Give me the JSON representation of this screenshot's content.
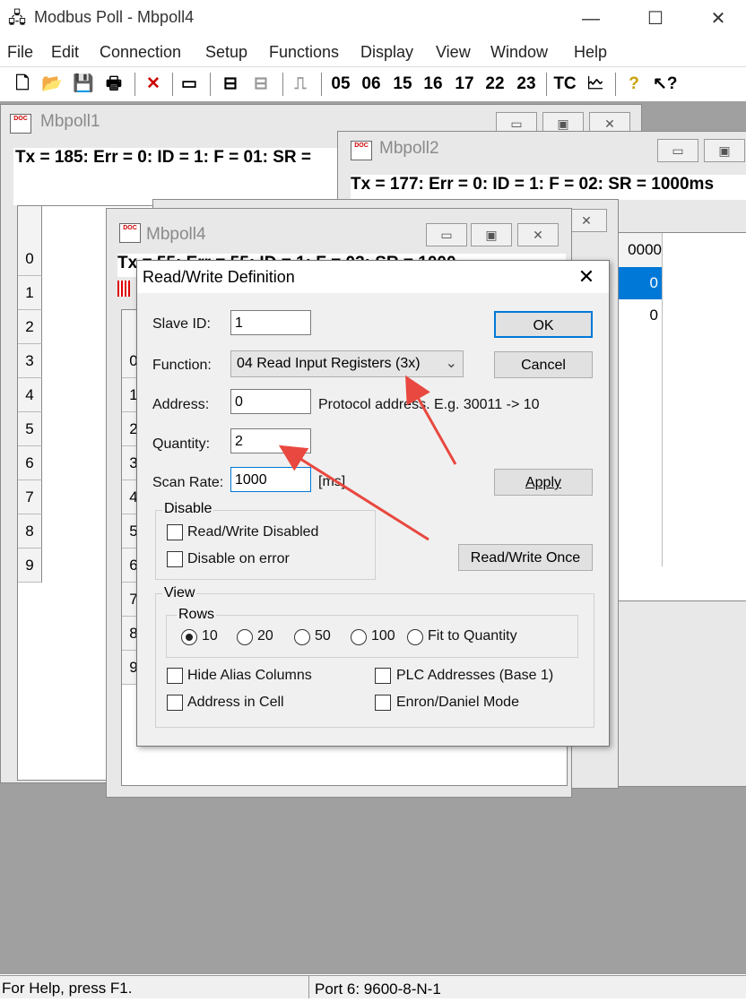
{
  "window": {
    "title": "Modbus Poll - Mbpoll4",
    "minimize_glyph": "—",
    "maximize_glyph": "☐",
    "close_glyph": "✕"
  },
  "menu": [
    "File",
    "Edit",
    "Connection",
    "Setup",
    "Functions",
    "Display",
    "View",
    "Window",
    "Help"
  ],
  "toolbar": {
    "function_codes": [
      "05",
      "06",
      "15",
      "16",
      "17",
      "22",
      "23"
    ],
    "tc_label": "TC"
  },
  "child_windows": {
    "mbpoll1": {
      "title": "Mbpoll1",
      "status": "Tx = 185: Err = 0: ID = 1: F = 01: SR = ",
      "rows": [
        "0",
        "1",
        "2",
        "3",
        "4",
        "5",
        "6",
        "7",
        "8",
        "9"
      ]
    },
    "mbpoll2": {
      "title": "Mbpoll2",
      "status": "Tx = 177: Err = 0: ID = 1: F = 02: SR = 1000ms",
      "header_value": "0000",
      "values": [
        "0",
        "0"
      ]
    },
    "mbpoll4": {
      "title": "Mbpoll4",
      "status": "Tx = 55: Err = 55: ID = 1: F = 03: SR = 1000",
      "rows": [
        "0",
        "1",
        "2",
        "3",
        "4",
        "5",
        "6",
        "7",
        "8",
        "9"
      ]
    }
  },
  "dialog": {
    "title": "Read/Write Definition",
    "slave_id_label": "Slave ID:",
    "slave_id_value": "1",
    "function_label": "Function:",
    "function_value": "04 Read Input Registers (3x)",
    "address_label": "Address:",
    "address_value": "0",
    "address_hint": "Protocol address. E.g. 30011 -> 10",
    "quantity_label": "Quantity:",
    "quantity_value": "2",
    "scan_rate_label": "Scan Rate:",
    "scan_rate_value": "1000",
    "scan_rate_unit": "[ms]",
    "ok_label": "OK",
    "cancel_label": "Cancel",
    "apply_label": "Apply",
    "rw_once_label": "Read/Write Once",
    "disable_group": "Disable",
    "rw_disabled_label": "Read/Write Disabled",
    "disable_on_error_label": "Disable on error",
    "view_group": "View",
    "rows_group": "Rows",
    "rows_options": [
      "10",
      "20",
      "50",
      "100",
      "Fit to Quantity"
    ],
    "rows_selected": "10",
    "hide_alias_label": "Hide Alias Columns",
    "address_in_cell_label": "Address in Cell",
    "plc_addresses_label": "PLC Addresses (Base 1)",
    "enron_label": "Enron/Daniel Mode"
  },
  "statusbar": {
    "help": "For Help, press F1.",
    "port": "Port 6: 9600-8-N-1"
  },
  "colors": {
    "mdi_background": "#a0a0a0",
    "selection": "#0078d7",
    "annotation_arrow": "#e8483f"
  }
}
